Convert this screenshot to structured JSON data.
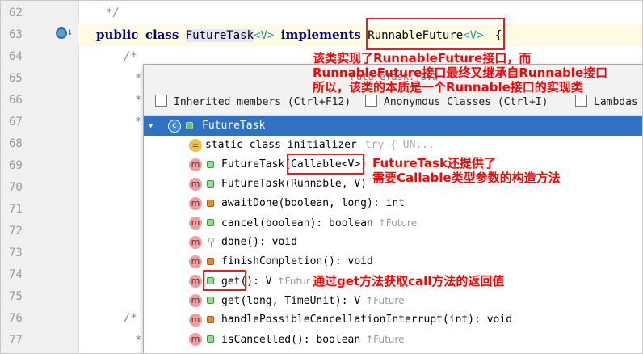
{
  "editor": {
    "line_numbers": [
      "62",
      "63",
      "64",
      "65",
      "66",
      "67",
      "68",
      "69",
      "70",
      "71",
      "72",
      "73",
      "74",
      "75",
      "76",
      "77"
    ],
    "line62": "*/",
    "line63": {
      "kw1": "public",
      "kw2": "class",
      "name": "FutureTask",
      "tparam": "<V>",
      "kw3": "implements",
      "iface": "RunnableFuture",
      "iface_tparam": "<V>",
      "brace": "{"
    },
    "line64": "/*",
    "comment_star": "*"
  },
  "popup": {
    "title": "FutureTask.java",
    "options": [
      {
        "label": "Inherited members (Ctrl+F12)"
      },
      {
        "label": "Anonymous Classes (Ctrl+I)"
      },
      {
        "label": "Lambdas"
      }
    ],
    "root": "FutureTask",
    "items": [
      {
        "sig": "static class initializer",
        "extra": "try {            UN...",
        "kind": "initializer"
      },
      {
        "sig_a": "FutureTask(",
        "sig_b": "Callable<V>",
        "sig_c": ")",
        "kind": "public"
      },
      {
        "sig": "FutureTask(Runnable, V)",
        "kind": "public"
      },
      {
        "sig": "awaitDone(boolean, long): int",
        "kind": "private"
      },
      {
        "sig": "cancel(boolean): boolean",
        "inherited": "↑Future",
        "kind": "public"
      },
      {
        "sig": "done(): void",
        "kind": "package"
      },
      {
        "sig": "finishCompletion(): void",
        "kind": "private"
      },
      {
        "sig_a": "get(): V",
        "inherited": "↑Futur",
        "kind": "public"
      },
      {
        "sig": "get(long, TimeUnit): V",
        "inherited": "↑Future",
        "kind": "public"
      },
      {
        "sig": "handlePossibleCancellationInterrupt(int): void",
        "kind": "private"
      },
      {
        "sig": "isCancelled(): boolean",
        "inherited": "↑Future",
        "kind": "public"
      }
    ]
  },
  "annotations": {
    "note1_line1": "该类实现了RunnableFuture接口，而",
    "note1_line2": "RunnableFuture接口最终又继承自Runnable接口",
    "note1_line3": "所以，该类的本质是一个Runnable接口的实现类",
    "note2_line1": "FutureTask还提供了",
    "note2_line2": "需要Callable类型参数的构造方法",
    "note3": "通过get方法获取call方法的返回值"
  },
  "colors": {
    "selection": "#2f72c4",
    "annotation_red": "#ff0000",
    "keyword": "#000080",
    "type_param": "#20999d"
  },
  "icons": {
    "gutter": "implemented-interface-icon",
    "method": "m",
    "class": "c",
    "initializer": "="
  }
}
